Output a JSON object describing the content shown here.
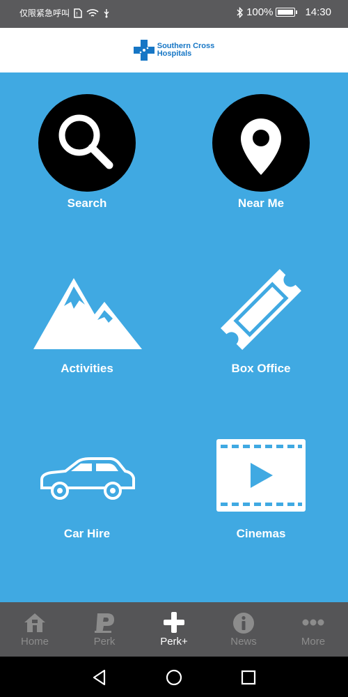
{
  "status_bar": {
    "carrier_text": "仅限紧急呼叫",
    "battery": "100%",
    "time": "14:30",
    "icons": [
      "sim-icon",
      "wifi-icon",
      "usb-icon",
      "bluetooth-icon",
      "battery-icon"
    ]
  },
  "header": {
    "logo_line1": "Southern Cross",
    "logo_line2": "Hospitals"
  },
  "tiles": [
    {
      "label": "Search",
      "icon": "search-icon"
    },
    {
      "label": "Near Me",
      "icon": "location-pin-icon"
    },
    {
      "label": "Activities",
      "icon": "mountain-icon"
    },
    {
      "label": "Box Office",
      "icon": "ticket-icon"
    },
    {
      "label": "Car Hire",
      "icon": "car-icon"
    },
    {
      "label": "Cinemas",
      "icon": "film-play-icon"
    }
  ],
  "tabbar": {
    "items": [
      {
        "label": "Home",
        "icon": "home-icon"
      },
      {
        "label": "Perk",
        "icon": "perk-p-icon"
      },
      {
        "label": "Perk+",
        "icon": "plus-icon",
        "active": true
      },
      {
        "label": "News",
        "icon": "info-icon"
      },
      {
        "label": "More",
        "icon": "more-dots-icon"
      }
    ]
  },
  "colors": {
    "background": "#40a9e2",
    "tabbar": "#555557",
    "status_bar": "#5a5a5c",
    "brand": "#1676c5"
  }
}
